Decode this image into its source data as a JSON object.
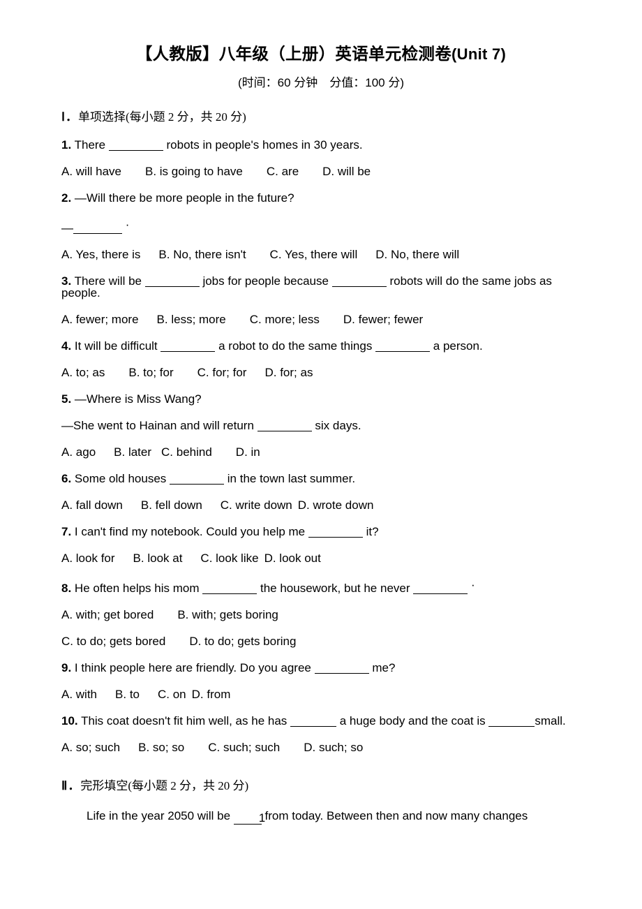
{
  "document": {
    "title_cn": "【人教版】八年级（上册）英语单元检测卷",
    "title_latin": "(Unit 7)",
    "subtitle": "(时间：60 分钟　分值：100 分)"
  },
  "sections": [
    {
      "numeral": "Ⅰ．",
      "heading": "单项选择(每小题 2 分，共 20 分)"
    },
    {
      "numeral": "Ⅱ．",
      "heading": "完形填空(每小题 2 分，共 20 分)"
    }
  ],
  "questions": [
    {
      "num": "1.",
      "stem_a": "There",
      "stem_b": "robots in people's homes in 30 years.",
      "options": [
        "A. will have",
        "B. is going to have",
        "C. are",
        "D. will be"
      ]
    },
    {
      "num": "2.",
      "stem_a": "—Will there be more people in the future?",
      "answer_dash": "—",
      "answer_dot": "·",
      "options": [
        "A. Yes, there is",
        "B. No, there isn't",
        "C. Yes, there will",
        "D. No, there will"
      ]
    },
    {
      "num": "3.",
      "stem_a": "There will be",
      "stem_b": "jobs for people because",
      "stem_c": "robots will do the same jobs as people.",
      "options": [
        "A. fewer; more",
        "B. less; more",
        "C. more; less",
        "D. fewer; fewer"
      ]
    },
    {
      "num": "4.",
      "stem_a": "It will be difficult",
      "stem_b": "a robot to do the same things",
      "stem_c": "a person.",
      "options": [
        "A. to; as",
        "B. to; for",
        "C. for; for",
        "D. for; as"
      ]
    },
    {
      "num": "5.",
      "stem_a": "—Where is Miss Wang?",
      "stem_b": "—She went to Hainan and will return",
      "stem_c": "six days.",
      "options": [
        "A. ago",
        "B. later",
        "C. behind",
        "D. in"
      ]
    },
    {
      "num": "6.",
      "stem_a": "Some old houses",
      "stem_b": "in the town last summer.",
      "options": [
        "A. fall down",
        "B. fell down",
        "C. write down",
        "D. wrote down"
      ]
    },
    {
      "num": "7.",
      "stem_a": "I can't find my notebook. Could you help me",
      "stem_b": "it?",
      "options": [
        "A. look for",
        "B. look at",
        "C. look like",
        "D. look out"
      ]
    },
    {
      "num": "8.",
      "stem_a": "He often helps his mom",
      "stem_b": "the housework, but he never",
      "stem_c": "·",
      "options": [
        "A. with; get bored",
        "B. with; gets boring",
        "C. to do; gets bored",
        "D. to do; gets boring"
      ]
    },
    {
      "num": "9.",
      "stem_a": "I think people here are friendly. Do you agree",
      "stem_b": "me?",
      "options": [
        "A. with",
        "B. to",
        "C. on",
        "D. from"
      ]
    },
    {
      "num": "10.",
      "stem_a": "This coat doesn't fit him well, as he has",
      "stem_b": "a huge body and the coat is",
      "stem_c": "small.",
      "options": [
        "A. so; such",
        "B. so; so",
        "C. such; such",
        "D. such; so"
      ]
    }
  ],
  "cloze": {
    "text_a": "Life in the year 2050 will be",
    "blank_1": "1",
    "text_b": "from today. Between then and now many changes"
  }
}
